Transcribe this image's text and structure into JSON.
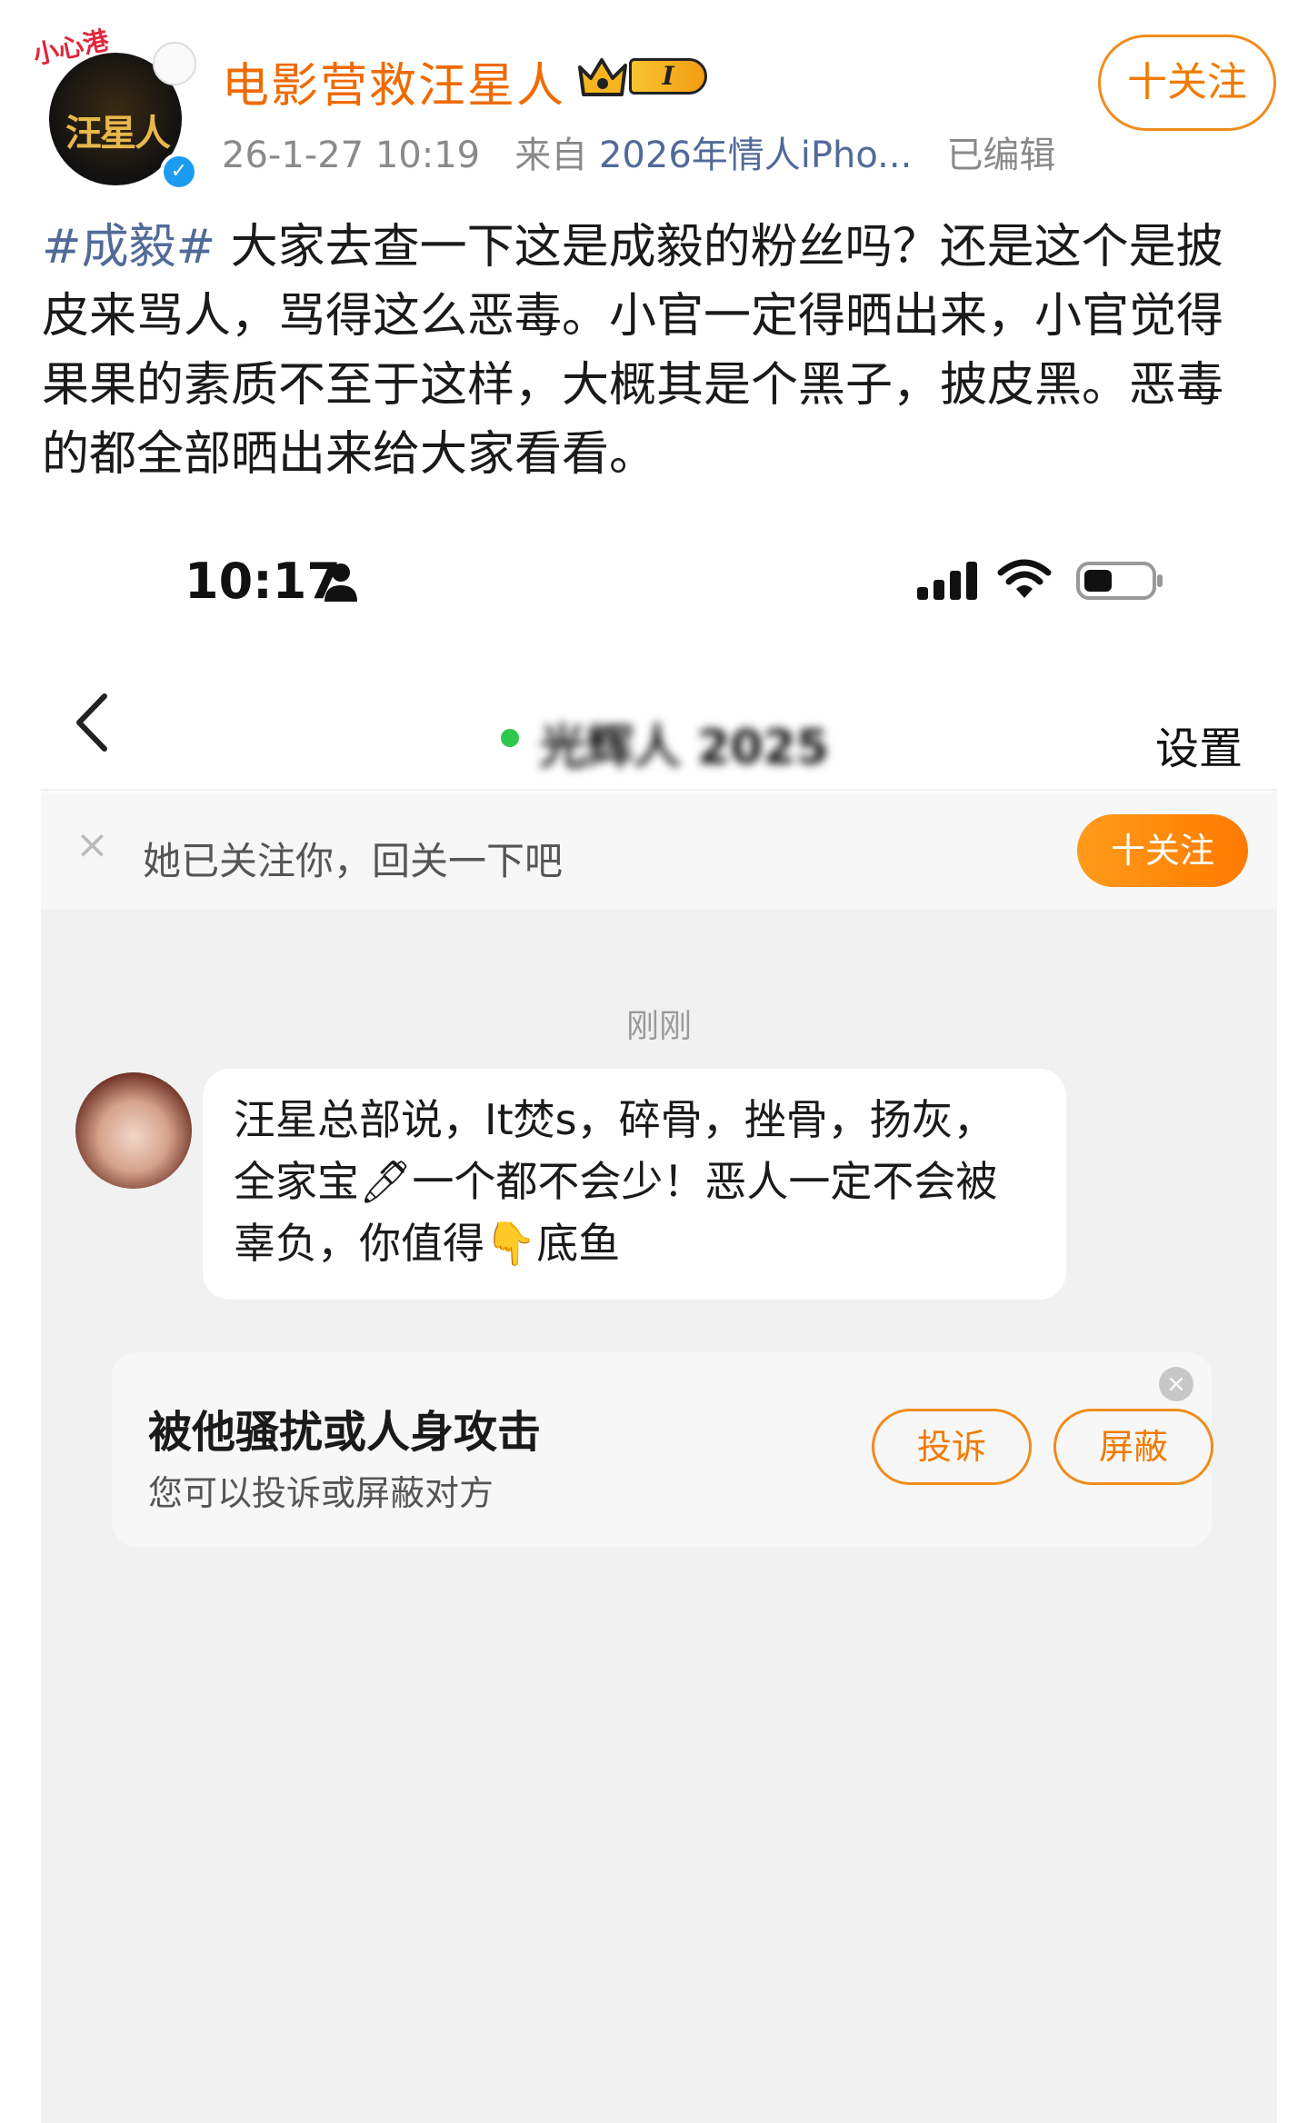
{
  "post": {
    "avatar_badge_text": "小心港",
    "avatar_logo_text": "汪星人",
    "username": "电影营救汪星人",
    "level_badge": "I",
    "timestamp": "26-1-27 10:19",
    "source_prefix": "来自",
    "source_device": "2026年情人iPho...",
    "edited": "已编辑",
    "follow_label": "十关注",
    "hashtag": "#成毅#",
    "body": " 大家去查一下这是成毅的粉丝吗？还是这个是披皮来骂人，骂得这么恶毒。小官一定得晒出来，小官觉得果果的素质不至于这样，大概其是个黑子，披皮黑。恶毒的都全部晒出来给大家看看。"
  },
  "screenshot": {
    "status_time": "10:17",
    "chat_name_blurred": "光辉人 2025",
    "settings": "设置",
    "follow_hint": "她已关注你，回关一下吧",
    "follow_pill": "十关注",
    "message_time": "刚刚",
    "message_text": "汪星总部说，It焚s，碎骨，挫骨，扬灰，全家宝🖊一个都不会少！恶人一定不会被辜负，你值得👇底鱼",
    "report_title": "被他骚扰或人身攻击",
    "report_sub": "您可以投诉或屏蔽对方",
    "complain_btn": "投诉",
    "block_btn": "屏蔽"
  },
  "colors": {
    "accent_orange": "#f07b00",
    "link_blue": "#506b99",
    "online_green": "#2dc84d"
  }
}
